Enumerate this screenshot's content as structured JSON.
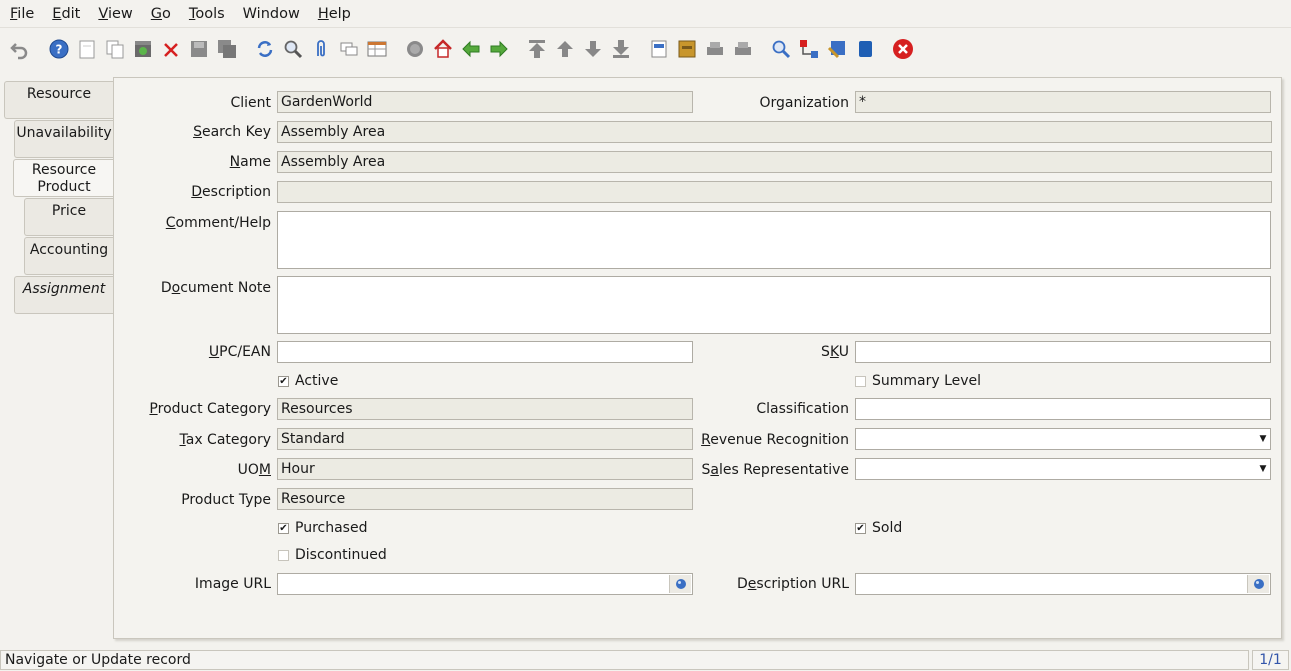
{
  "menu": [
    {
      "pre": "",
      "u": "F",
      "post": "ile"
    },
    {
      "pre": "",
      "u": "E",
      "post": "dit"
    },
    {
      "pre": "",
      "u": "V",
      "post": "iew"
    },
    {
      "pre": "",
      "u": "G",
      "post": "o"
    },
    {
      "pre": "",
      "u": "T",
      "post": "ools"
    },
    {
      "pre": "",
      "u": "",
      "post": "Window"
    },
    {
      "pre": "",
      "u": "H",
      "post": "elp"
    }
  ],
  "tabs": [
    {
      "label": "Resource"
    },
    {
      "label": "Unavailability"
    },
    {
      "label": "Resource Product"
    },
    {
      "label": "Price"
    },
    {
      "label": "Accounting"
    },
    {
      "label": "Assignment"
    }
  ],
  "form": {
    "client": {
      "pre": "Client",
      "u": "",
      "post": "",
      "value": "GardenWorld"
    },
    "organization": {
      "pre": "Organization",
      "u": "",
      "post": "",
      "value": "*"
    },
    "search_key": {
      "pre": "",
      "u": "S",
      "post": "earch Key",
      "value": "Assembly Area"
    },
    "name": {
      "pre": "",
      "u": "N",
      "post": "ame",
      "value": "Assembly Area"
    },
    "description": {
      "pre": "",
      "u": "D",
      "post": "escription",
      "value": ""
    },
    "comment": {
      "pre": "",
      "u": "C",
      "post": "omment/Help",
      "value": ""
    },
    "document_note": {
      "pre": "D",
      "u": "o",
      "post": "cument Note",
      "value": ""
    },
    "upc": {
      "pre": "",
      "u": "U",
      "post": "PC/EAN",
      "value": ""
    },
    "sku": {
      "pre": "S",
      "u": "K",
      "post": "U",
      "value": ""
    },
    "active": {
      "label": "Active",
      "checked": "✔"
    },
    "summary_level": {
      "label": "Summary Level",
      "checked": ""
    },
    "product_category": {
      "pre": "",
      "u": "P",
      "post": "roduct Category",
      "value": "Resources"
    },
    "classification": {
      "pre": "Classification",
      "u": "",
      "post": "",
      "value": ""
    },
    "tax_category": {
      "pre": "",
      "u": "T",
      "post": "ax Category",
      "value": "Standard"
    },
    "revenue_recognition": {
      "pre": "",
      "u": "R",
      "post": "evenue Recognition",
      "value": ""
    },
    "uom": {
      "pre": "UO",
      "u": "M",
      "post": "",
      "value": "Hour"
    },
    "sales_rep": {
      "pre": "S",
      "u": "a",
      "post": "les Representative",
      "value": ""
    },
    "product_type": {
      "pre": "Product Type",
      "u": "",
      "post": "",
      "value": "Resource"
    },
    "purchased": {
      "label": "Purchased",
      "checked": "✔"
    },
    "sold": {
      "label": "Sold",
      "checked": "✔"
    },
    "discontinued": {
      "label": "Discontinued",
      "checked": ""
    },
    "image_url": {
      "pre": "Image URL",
      "u": "",
      "post": "",
      "value": ""
    },
    "description_url": {
      "pre": "D",
      "u": "e",
      "post": "scription URL",
      "value": ""
    }
  },
  "status": {
    "message": "Navigate or Update record",
    "count": "1/1"
  },
  "colors": {
    "accent": "#3355aa",
    "readonly_bg": "#ecebe3",
    "delete_red": "#d62020"
  }
}
